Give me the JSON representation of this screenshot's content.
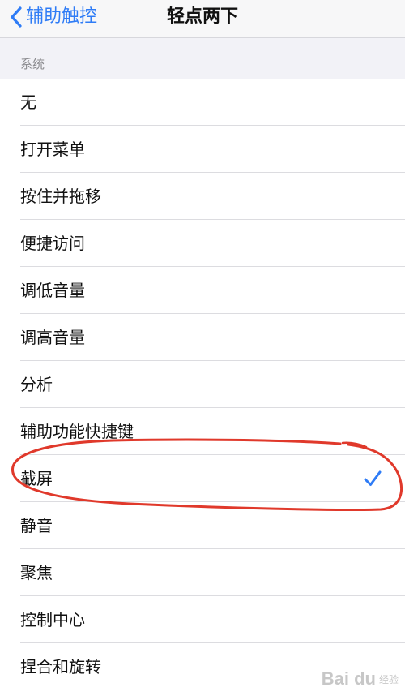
{
  "nav": {
    "back_label": "辅助触控",
    "title": "轻点两下"
  },
  "section": {
    "header": "系统"
  },
  "items": [
    {
      "label": "无",
      "selected": false
    },
    {
      "label": "打开菜单",
      "selected": false
    },
    {
      "label": "按住并拖移",
      "selected": false
    },
    {
      "label": "便捷访问",
      "selected": false
    },
    {
      "label": "调低音量",
      "selected": false
    },
    {
      "label": "调高音量",
      "selected": false
    },
    {
      "label": "分析",
      "selected": false
    },
    {
      "label": "辅助功能快捷键",
      "selected": false
    },
    {
      "label": "截屏",
      "selected": true
    },
    {
      "label": "静音",
      "selected": false
    },
    {
      "label": "聚焦",
      "selected": false
    },
    {
      "label": "控制中心",
      "selected": false
    },
    {
      "label": "捏合和旋转",
      "selected": false
    }
  ],
  "colors": {
    "accent": "#2f7cf6",
    "annotation": "#e0392b"
  },
  "watermark": {
    "brand": "Bai du",
    "sub": "经验"
  }
}
